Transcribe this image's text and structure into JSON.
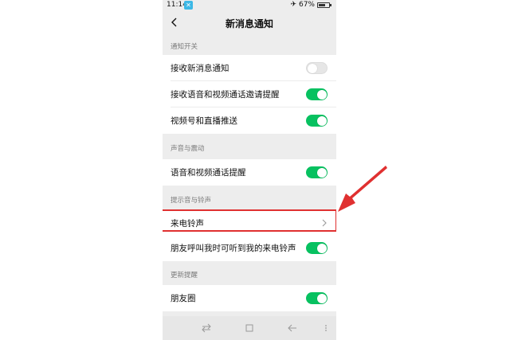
{
  "status_bar": {
    "time": "11:14",
    "battery_percent": "67%",
    "battery_level": 0.67
  },
  "nav": {
    "title": "新消息通知"
  },
  "sections": [
    {
      "header": "通知开关",
      "rows": [
        {
          "label": "接收新消息通知",
          "toggle": false
        },
        {
          "label": "接收语音和视频通话邀请提醒",
          "toggle": true
        },
        {
          "label": "视频号和直播推送",
          "toggle": true
        }
      ]
    },
    {
      "header": "声音与震动",
      "rows": [
        {
          "label": "语音和视频通话提醒",
          "toggle": true
        }
      ]
    },
    {
      "header": "提示音与铃声",
      "rows": [
        {
          "label": "来电铃声"
        },
        {
          "label": "朋友呼叫我时可听到我的来电铃声",
          "toggle": true
        }
      ]
    },
    {
      "header": "更新提醒",
      "rows": [
        {
          "label": "朋友圈",
          "toggle": true
        }
      ]
    }
  ],
  "colors": {
    "toggle_on": "#07c160",
    "highlight": "#e03030",
    "background": "#ededed"
  }
}
